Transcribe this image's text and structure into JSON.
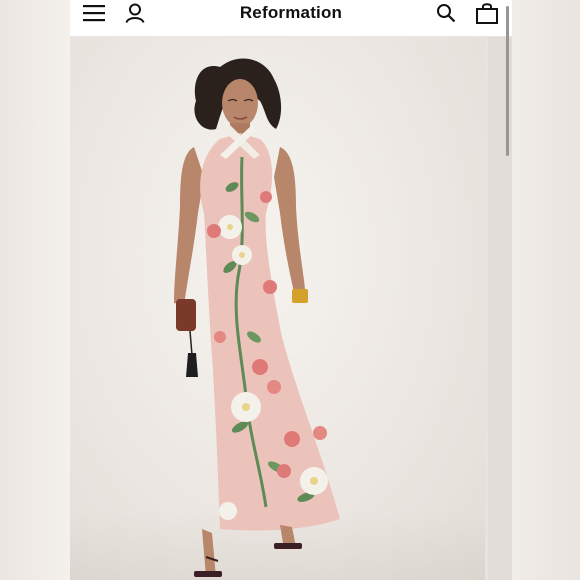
{
  "header": {
    "brand": "Reformation",
    "icons": [
      "menu-icon",
      "account-icon",
      "search-icon",
      "bag-icon"
    ]
  },
  "product_image": {
    "subject": "model-in-floral-halter-maxi-dress",
    "colors": {
      "dress": "#ecc3bb",
      "flowers_white": "#f4f1ea",
      "flowers_pink": "#e07a78",
      "leaves": "#5e8a55",
      "skin": "#b8866a",
      "hair": "#2a211d"
    }
  }
}
